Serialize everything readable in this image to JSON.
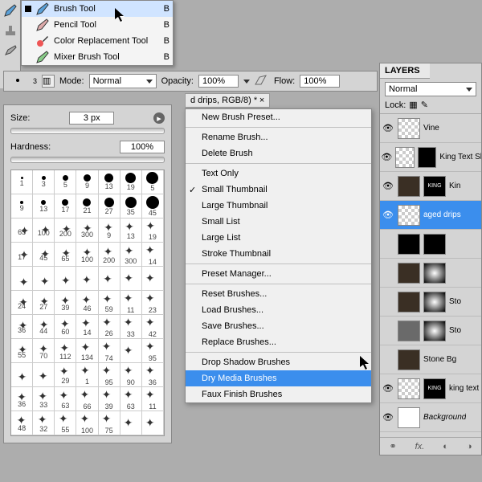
{
  "tools": {
    "items": [
      {
        "label": "Brush Tool",
        "key": "B",
        "selected": true
      },
      {
        "label": "Pencil Tool",
        "key": "B",
        "selected": false
      },
      {
        "label": "Color Replacement Tool",
        "key": "B",
        "selected": false
      },
      {
        "label": "Mixer Brush Tool",
        "key": "B",
        "selected": false
      }
    ]
  },
  "options": {
    "mode_label": "Mode:",
    "mode_value": "Normal",
    "opacity_label": "Opacity:",
    "opacity_value": "100%",
    "flow_label": "Flow:",
    "flow_value": "100%"
  },
  "doc_tab": "d drips, RGB/8) *",
  "brush_panel": {
    "size_label": "Size:",
    "size_value": "3 px",
    "hardness_label": "Hardness:",
    "hardness_value": "100%",
    "cells": [
      1,
      3,
      5,
      9,
      13,
      19,
      5,
      9,
      13,
      17,
      21,
      27,
      35,
      45,
      65,
      100,
      200,
      300,
      9,
      13,
      19,
      17,
      45,
      65,
      100,
      200,
      300,
      14,
      "",
      "",
      "",
      "",
      "",
      "",
      "",
      24,
      27,
      39,
      46,
      59,
      11,
      23,
      36,
      44,
      60,
      14,
      26,
      33,
      42,
      55,
      70,
      112,
      134,
      74,
      "",
      "95",
      "",
      "",
      "29",
      1,
      95,
      90,
      36,
      36,
      33,
      63,
      66,
      39,
      63,
      11,
      48,
      32,
      55,
      100,
      75
    ]
  },
  "context_menu": {
    "items": [
      {
        "label": "New Brush Preset...",
        "t": "i"
      },
      {
        "t": "s"
      },
      {
        "label": "Rename Brush...",
        "t": "i"
      },
      {
        "label": "Delete Brush",
        "t": "i"
      },
      {
        "t": "s"
      },
      {
        "label": "Text Only",
        "t": "i"
      },
      {
        "label": "Small Thumbnail",
        "t": "i",
        "check": true
      },
      {
        "label": "Large Thumbnail",
        "t": "i"
      },
      {
        "label": "Small List",
        "t": "i"
      },
      {
        "label": "Large List",
        "t": "i"
      },
      {
        "label": "Stroke Thumbnail",
        "t": "i"
      },
      {
        "t": "s"
      },
      {
        "label": "Preset Manager...",
        "t": "i"
      },
      {
        "t": "s"
      },
      {
        "label": "Reset Brushes...",
        "t": "i"
      },
      {
        "label": "Load Brushes...",
        "t": "i"
      },
      {
        "label": "Save Brushes...",
        "t": "i"
      },
      {
        "label": "Replace Brushes...",
        "t": "i"
      },
      {
        "t": "s"
      },
      {
        "label": "Drop Shadow Brushes",
        "t": "i"
      },
      {
        "label": "Dry Media Brushes",
        "t": "i",
        "sel": true
      },
      {
        "label": "Faux Finish Brushes",
        "t": "i"
      }
    ]
  },
  "layers": {
    "title": "LAYERS",
    "blend": "Normal",
    "lock_label": "Lock:",
    "items": [
      {
        "name": "Vine",
        "eye": true,
        "th": "chk2"
      },
      {
        "name": "King Text Sha",
        "eye": true,
        "th": "check",
        "th2": "mask"
      },
      {
        "name": "Kin",
        "eye": true,
        "th": "dark",
        "th2": "king"
      },
      {
        "name": "aged drips",
        "eye": true,
        "th": "check",
        "sel": true
      },
      {
        "name": "",
        "eye": false,
        "th": "mask",
        "th2": "mask"
      },
      {
        "name": "",
        "eye": false,
        "th": "dark",
        "th2": "rad"
      },
      {
        "name": "Sto",
        "eye": false,
        "th": "dark",
        "th2": "rad"
      },
      {
        "name": "Sto",
        "eye": false,
        "th": "noise",
        "th2": "rad"
      },
      {
        "name": "Stone Bg",
        "eye": false,
        "th": "dark"
      },
      {
        "name": "king text",
        "eye": true,
        "th": "chk2",
        "th2": "king"
      },
      {
        "name": "Background",
        "eye": true,
        "th": "white"
      }
    ]
  }
}
